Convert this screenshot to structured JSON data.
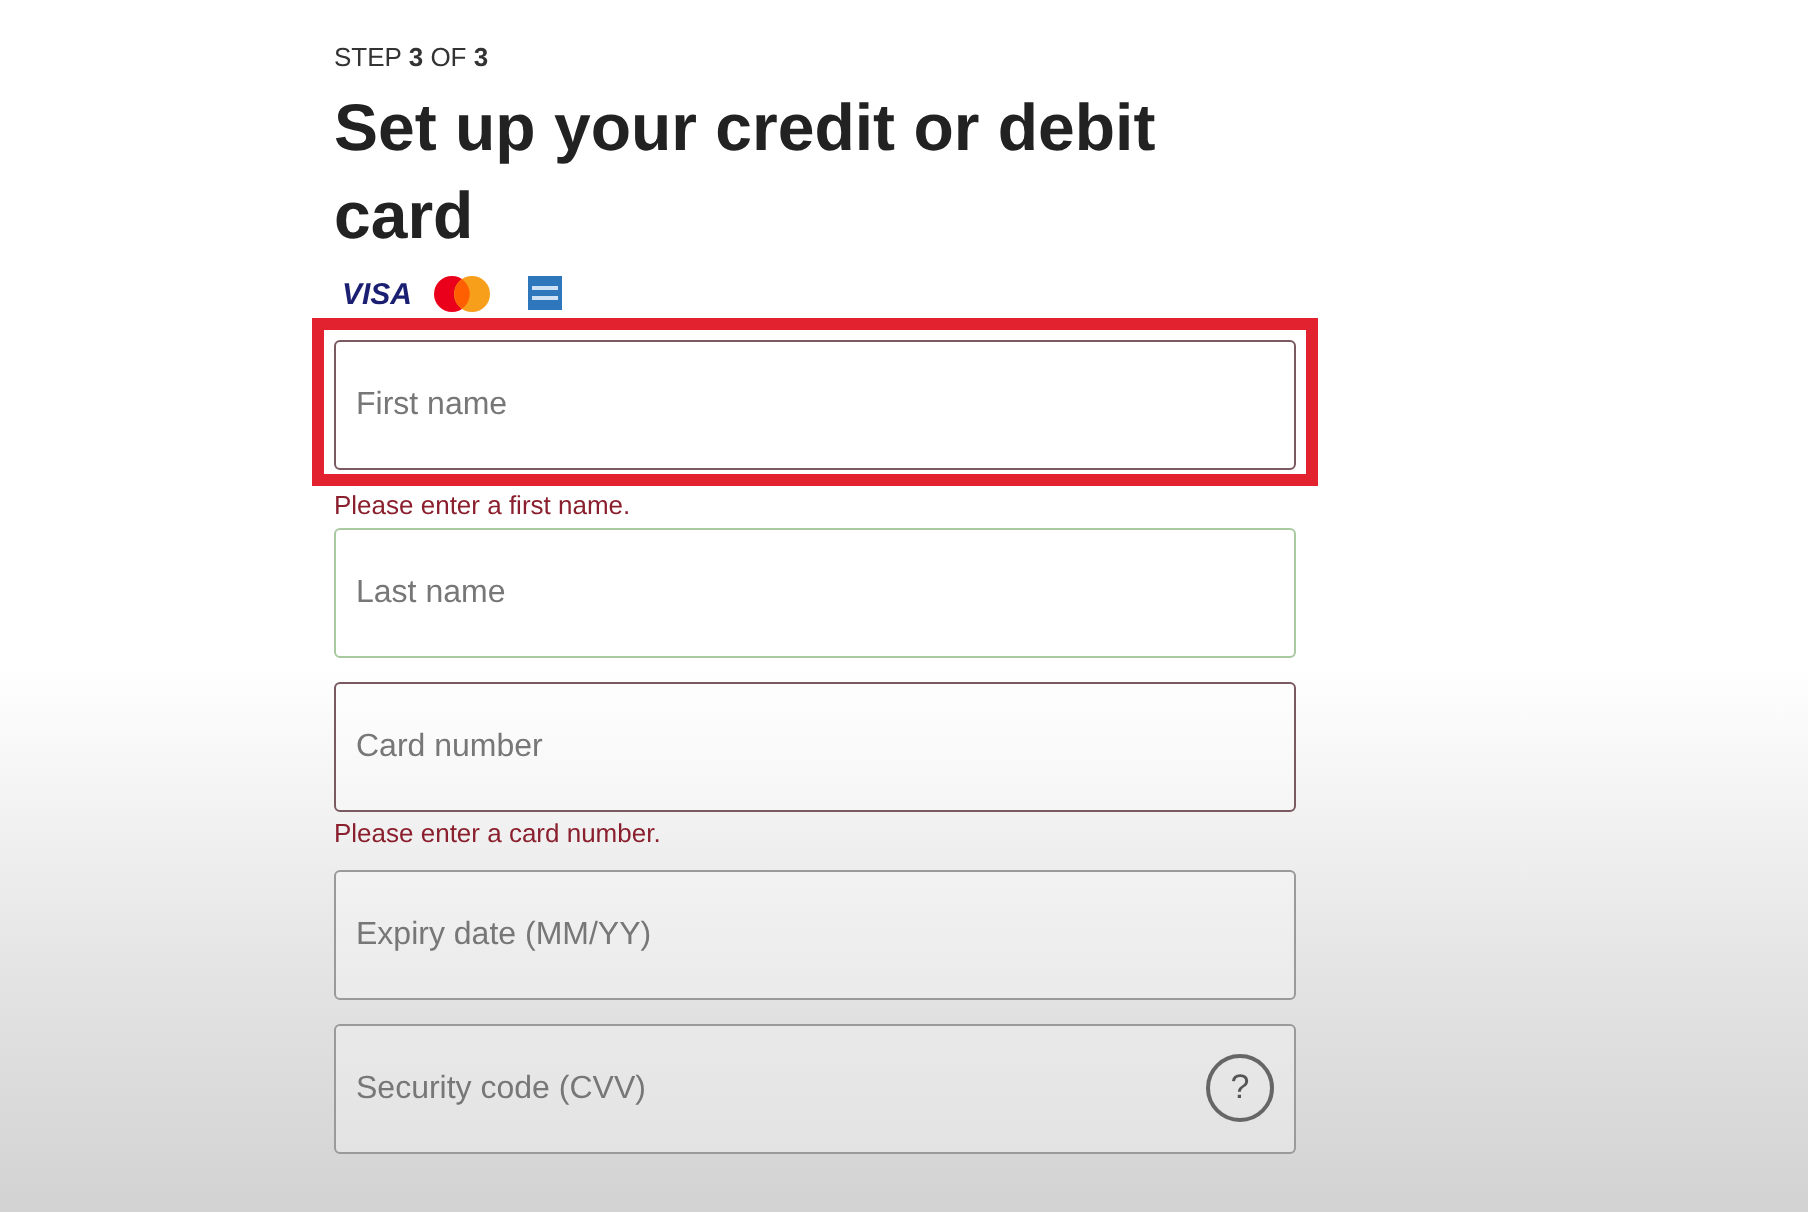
{
  "step": "STEP **3** OF **3**",
  "title": "Set up your credit or debit card",
  "card_logos": [
    {
      "kind": "visa",
      "text": "VISA"
    },
    {
      "kind": "mastercard"
    },
    {
      "kind": "amex"
    }
  ],
  "fields": [
    {
      "placeholder": "First name",
      "invalid": true,
      "valid": false,
      "highlighted": true,
      "error": "Please enter a first name."
    },
    {
      "placeholder": "Last name",
      "invalid": false,
      "valid": true,
      "highlighted": false
    },
    {
      "placeholder": "Card number",
      "invalid": true,
      "valid": false,
      "highlighted": false,
      "error": "Please enter a card number."
    },
    {
      "placeholder": "Expiry date (MM/YY)",
      "invalid": false,
      "valid": false,
      "highlighted": false
    },
    {
      "placeholder": "Security code (CVV)",
      "invalid": false,
      "valid": false,
      "highlighted": false,
      "help": "?"
    }
  ]
}
